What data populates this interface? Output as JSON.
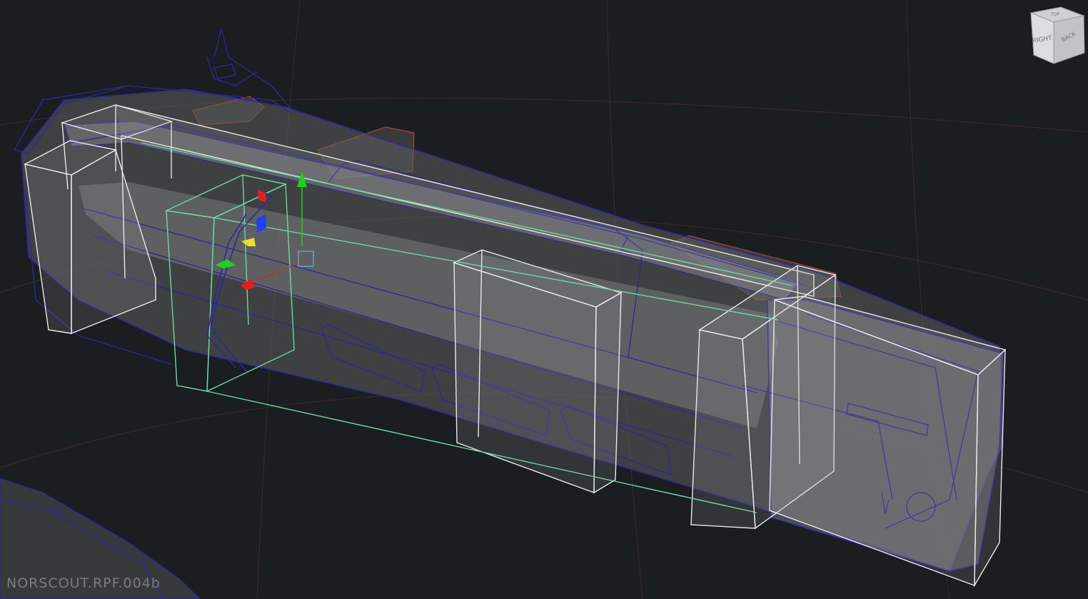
{
  "viewport": {
    "object_label": "NORSCOUT.RPF.004b",
    "background_color": "#1b1e20",
    "grid_color": "#4a2c28"
  },
  "view_cube": {
    "top_label": "TOP",
    "right_label": "RIGHT",
    "back_label": "BACK"
  },
  "gizmo": {
    "x_axis_color": "#e02020",
    "y_axis_color": "#20d020",
    "z_axis_color": "#2040f0",
    "screen_handle_color": "#e8e020"
  },
  "colors": {
    "selection_wire": "#6fd6a0",
    "bbox_wire": "#e8e8e8",
    "mesh_wire": "#2a2a9a"
  }
}
